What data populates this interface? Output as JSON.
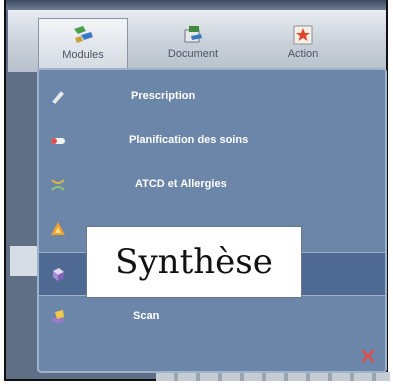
{
  "toolbar": {
    "buttons": [
      {
        "label": "Modules",
        "icon": "modules-icon",
        "active": true
      },
      {
        "label": "Document",
        "icon": "document-icon",
        "active": false
      },
      {
        "label": "Action",
        "icon": "action-icon",
        "active": false
      }
    ]
  },
  "menu": {
    "items": [
      {
        "label": "Prescription",
        "icon": "prescription-icon"
      },
      {
        "label": "Planification des soins",
        "icon": "planning-icon"
      },
      {
        "label": "ATCD et Allergies",
        "icon": "allergies-icon"
      },
      {
        "label": "",
        "icon": "alert-icon"
      },
      {
        "label": "",
        "icon": "synthese-icon",
        "selected": true
      },
      {
        "label": "Scan",
        "icon": "scan-icon"
      }
    ],
    "close_icon": "close-icon"
  },
  "overlay": {
    "label": "Synthèse"
  },
  "colors": {
    "panel": "#6c86aa",
    "selected_row": "#4e6a92",
    "close": "#e24b4b"
  }
}
